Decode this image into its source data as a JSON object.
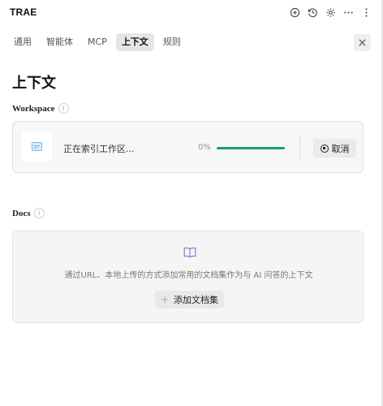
{
  "app": {
    "title": "TRAE"
  },
  "toolbar": {
    "icons": [
      "add-chat-icon",
      "history-icon",
      "settings-icon",
      "more-horizontal-icon",
      "more-vertical-icon"
    ]
  },
  "tabs": [
    {
      "label": "通用",
      "active": false
    },
    {
      "label": "智能体",
      "active": false
    },
    {
      "label": "MCP",
      "active": false
    },
    {
      "label": "上下文",
      "active": true
    },
    {
      "label": "规则",
      "active": false
    }
  ],
  "page": {
    "title": "上下文"
  },
  "workspace": {
    "label": "Workspace",
    "status": "正在索引工作区...",
    "progress_text": "0%",
    "progress_value": 0,
    "cancel_label": "取消",
    "accent": "#1a9e6b"
  },
  "docs": {
    "label": "Docs",
    "description": "通过URL、本地上传的方式添加常用的文档集作为与 AI 问答的上下文",
    "add_label": "添加文档集",
    "icon_color": "#8b7fd6"
  }
}
